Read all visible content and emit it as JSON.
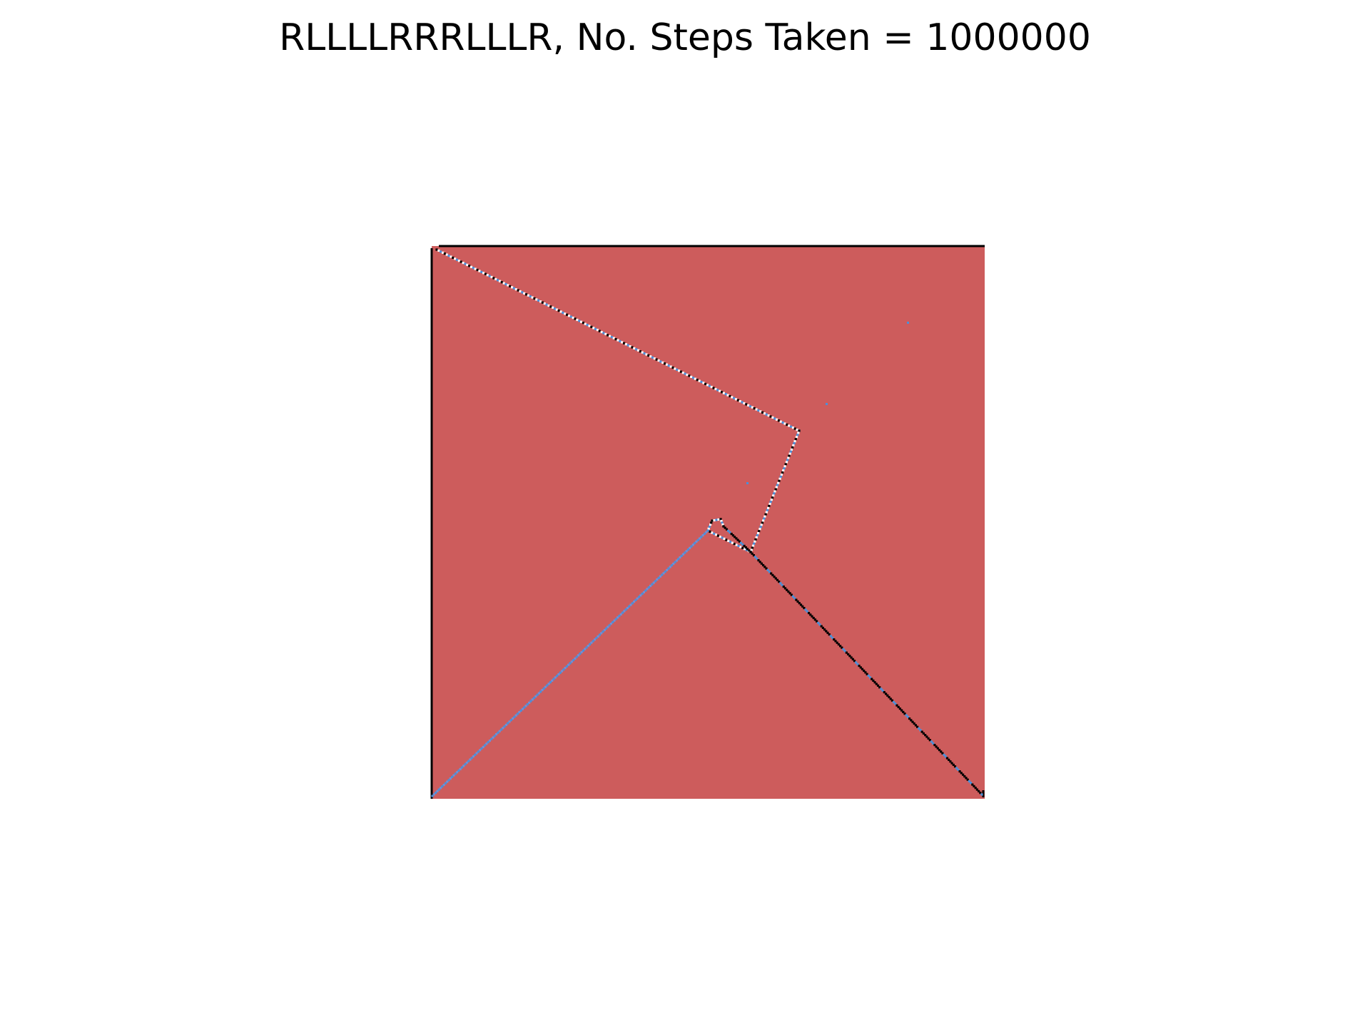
{
  "figure": {
    "title": "RLLLLRRRLLLR, No. Steps Taken = 1000000",
    "rule": "RLLLLRRRLLLR",
    "steps_taken": 1000000
  },
  "grid": {
    "background_color": "#cd5c5c",
    "border_color": "#000000",
    "trail_colors": [
      "#000000",
      "#ffffff",
      "#f2c12e",
      "#4a90d9",
      "#6f8fd6"
    ]
  }
}
